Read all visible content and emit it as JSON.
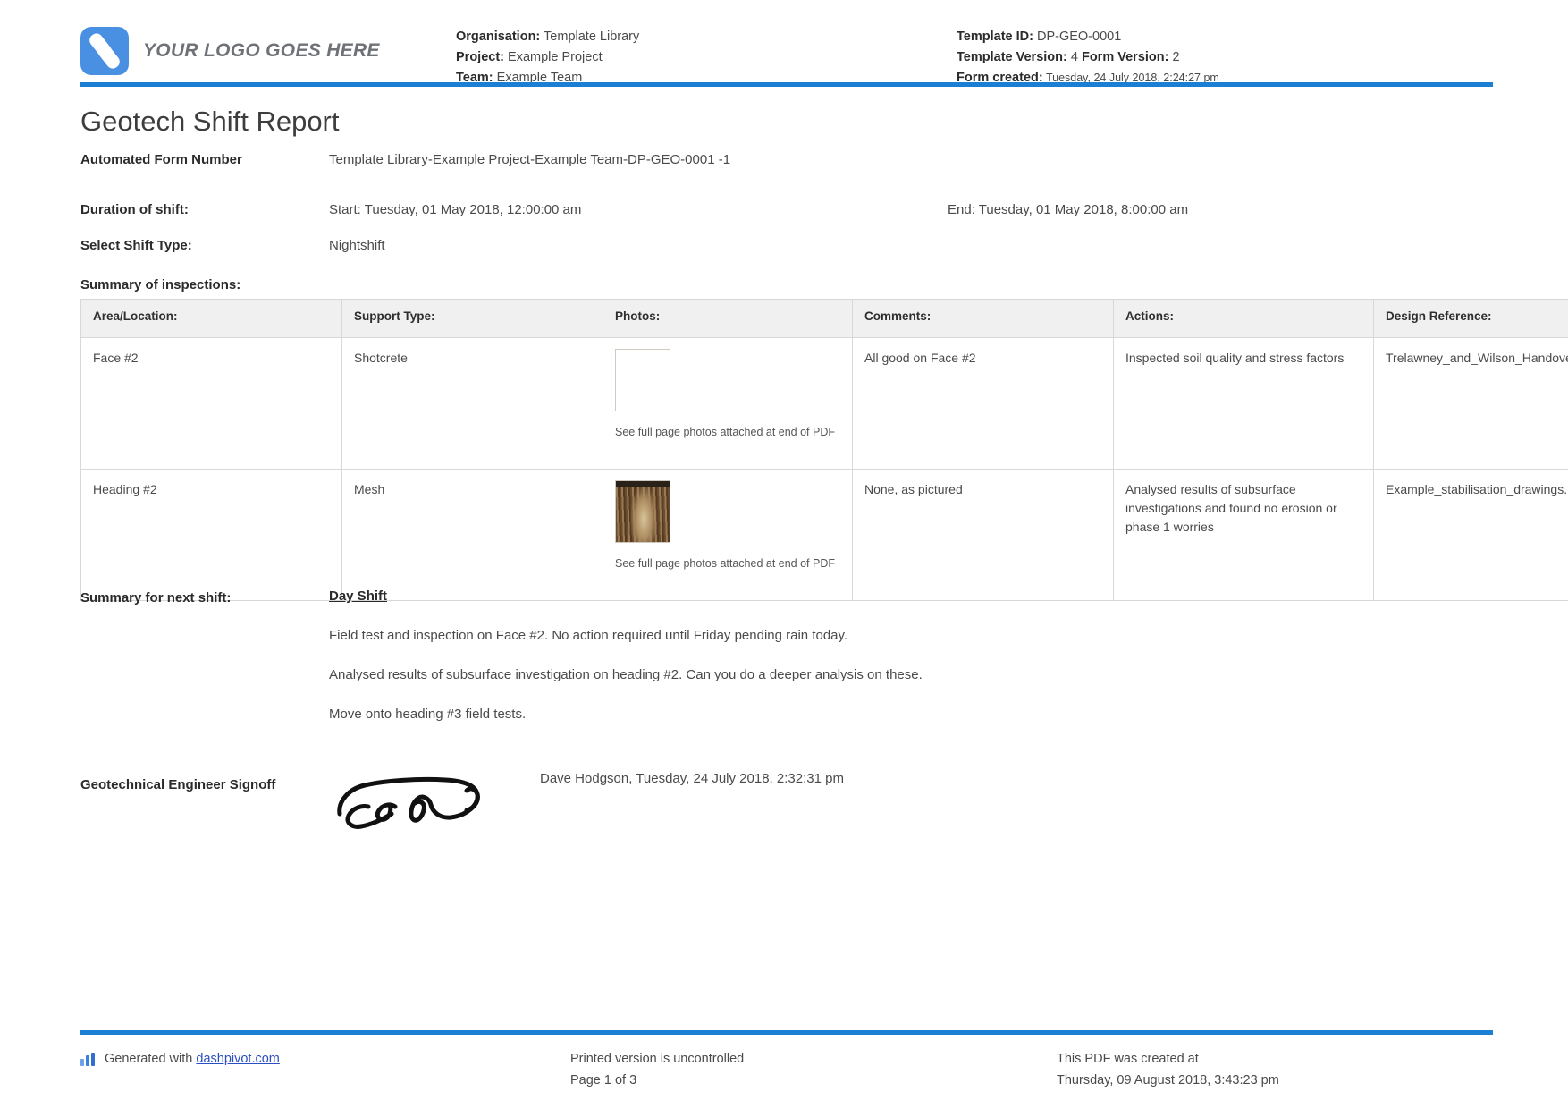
{
  "brand": {
    "accent_blue": "#1b7fd4",
    "logo_blue": "#4a90e2",
    "logo_text": "YOUR LOGO GOES HERE",
    "logo_icon": "dashpivot-logo-icon"
  },
  "header": {
    "middle": {
      "organisation_label": "Organisation:",
      "organisation_value": "Template Library",
      "project_label": "Project:",
      "project_value": "Example Project",
      "team_label": "Team:",
      "team_value": "Example Team"
    },
    "right": {
      "template_id_label": "Template ID:",
      "template_id_value": "DP-GEO-0001",
      "template_version_label": "Template Version:",
      "template_version_value": "4",
      "form_version_label": "Form Version:",
      "form_version_value": "2",
      "form_created_label": "Form created:",
      "form_created_value": "Tuesday, 24 July 2018, 2:24:27 pm"
    }
  },
  "title": "Geotech Shift Report",
  "fields": {
    "form_number_label": "Automated Form Number",
    "form_number_value": "Template Library-Example Project-Example Team-DP-GEO-0001    -1",
    "duration_label": "Duration of shift:",
    "duration_start": "Start: Tuesday, 01 May 2018, 12:00:00 am",
    "duration_end": "End: Tuesday, 01 May 2018, 8:00:00 am",
    "shift_type_label": "Select Shift Type:",
    "shift_type_value": "Nightshift"
  },
  "inspections": {
    "section_label": "Summary of inspections:",
    "columns": [
      "Area/Location:",
      "Support Type:",
      "Photos:",
      "Comments:",
      "Actions:",
      "Design Reference:"
    ],
    "photo_caption": "See full page photos attached at end of PDF",
    "rows": [
      {
        "area": "Face #2",
        "support": "Shotcrete",
        "photo_alt": "soil-face-photo",
        "comments": "All good on Face #2",
        "actions": "Inspected soil quality and stress factors",
        "design_reference": "Trelawney_and_Wilson_Handover.pdf"
      },
      {
        "area": "Heading #2",
        "support": "Mesh",
        "photo_alt": "tunnel-heading-photo",
        "comments": "None, as pictured",
        "actions": "Analysed results of subsurface investigations and found no erosion or phase 1 worries",
        "design_reference": "Example_stabilisation_drawings.pdf"
      }
    ]
  },
  "next_shift": {
    "label": "Summary for next shift:",
    "shift_name": "Day Shift",
    "paragraph_1": "Field test and inspection on Face #2. No action required until Friday pending rain today.",
    "paragraph_2": "Analysed results of subsurface investigation on heading #2. Can you do a deeper analysis on these.",
    "paragraph_3": "Move onto heading #3 field tests."
  },
  "signoff": {
    "label": "Geotechnical Engineer Signoff",
    "signature_alt": "handwritten-signature",
    "signed_by": "Dave Hodgson, Tuesday, 24 July 2018, 2:32:31 pm"
  },
  "footer": {
    "generated_prefix": "Generated with ",
    "generated_link": "dashpivot.com",
    "uncontrolled_notice": "Printed version is uncontrolled",
    "page_number": "Page 1 of 3",
    "created_label": "This PDF was created at",
    "created_value": "Thursday, 09 August 2018, 3:43:23 pm"
  }
}
